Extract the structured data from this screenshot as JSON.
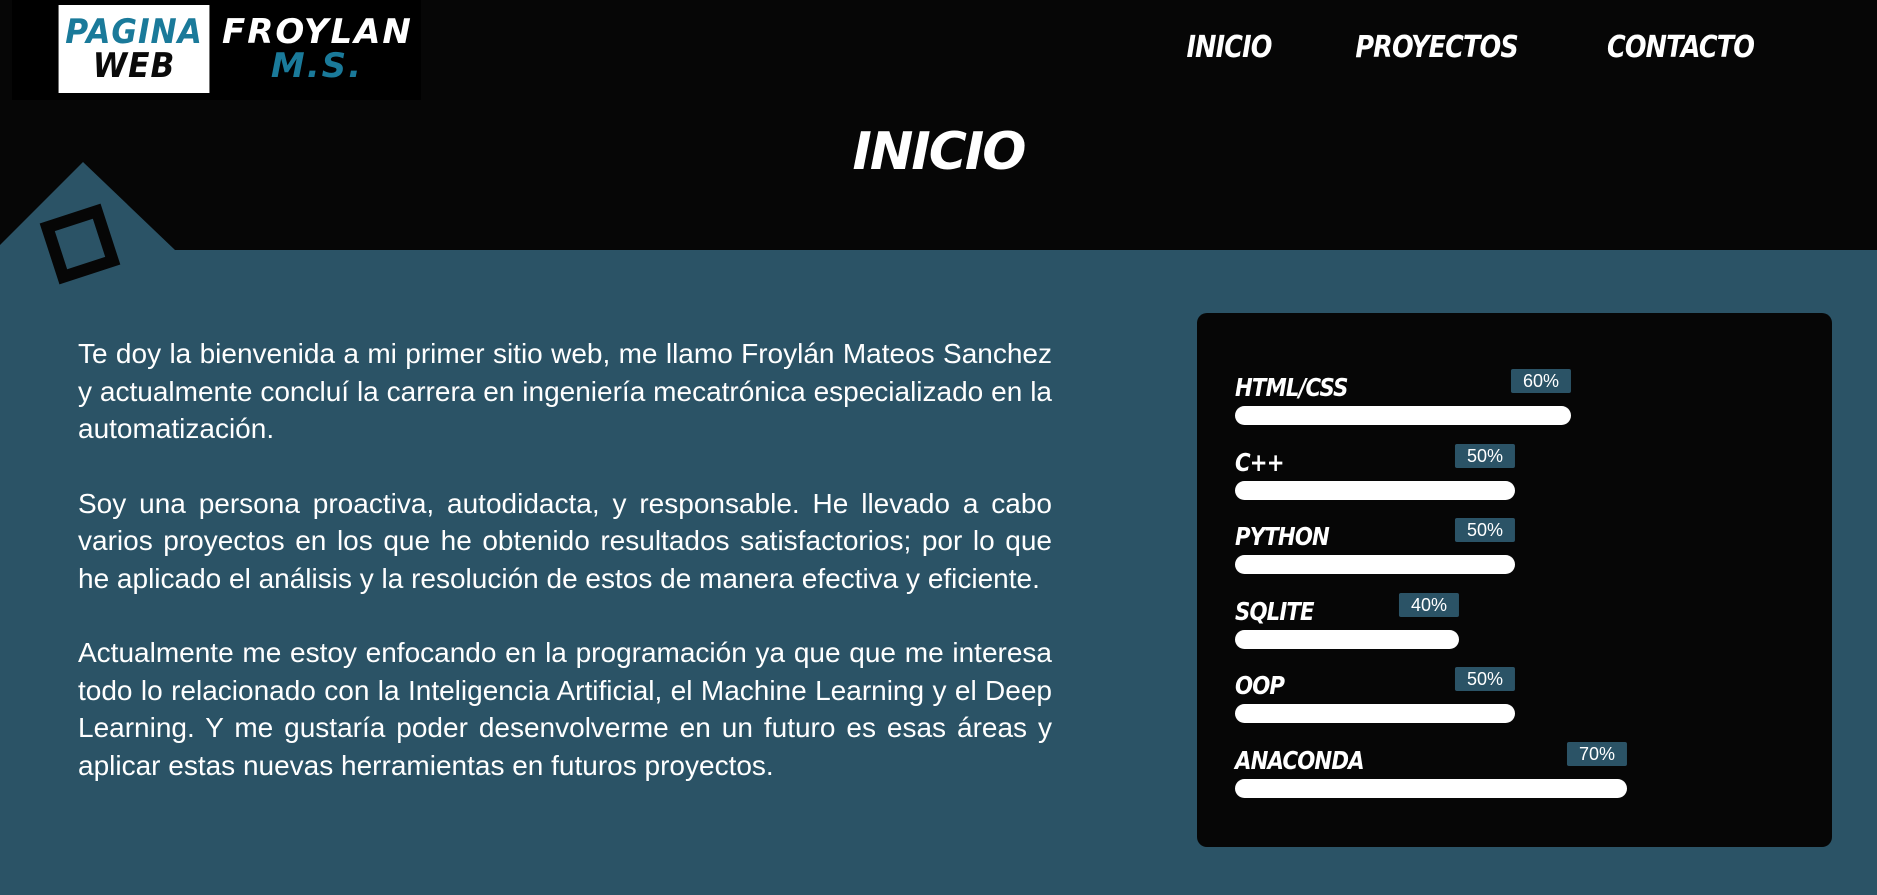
{
  "logo": {
    "left_line1": "PAGINA",
    "left_line2": "WEB",
    "right_line1": "FROYLAN",
    "right_line2": "M.S."
  },
  "nav": {
    "items": [
      "INICIO",
      "PROYECTOS",
      "CONTACTO"
    ]
  },
  "page": {
    "title": "INICIO"
  },
  "intro": {
    "paragraphs": [
      "Te doy la bienvenida a mi primer sitio web, me llamo Froylán Mateos Sanchez y actualmente concluí la carrera en ingeniería mecatrónica especializado en la automatización.",
      "Soy una persona proactiva, autodidacta, y responsable. He llevado a cabo varios proyectos en los que he obtenido resultados satisfactorios; por lo que he aplicado el análisis y la resolución de estos de manera efectiva y eficiente.",
      "Actualmente me estoy enfocando en la programación ya que que me interesa todo lo relacionado con la Inteligencia Artificial, el Machine Learning y el Deep Learning. Y me gustaría poder desenvolverme en un futuro es esas áreas y aplicar estas nuevas herramientas en futuros proyectos."
    ]
  },
  "skills": [
    {
      "name": "HTML/CSS",
      "label": "60%",
      "level": 0.6
    },
    {
      "name": "C++",
      "label": "50%",
      "level": 0.5
    },
    {
      "name": "PYTHON",
      "label": "50%",
      "level": 0.5
    },
    {
      "name": "SQLITE",
      "label": "40%",
      "level": 0.4
    },
    {
      "name": "OOP",
      "label": "50%",
      "level": 0.5
    },
    {
      "name": "ANACONDA",
      "label": "70%",
      "level": 0.7
    }
  ],
  "colors": {
    "background_dark": "#060606",
    "main_teal": "#2b5366",
    "logo_blue": "#1a7a9a",
    "bar_fill": "#ffffff"
  }
}
